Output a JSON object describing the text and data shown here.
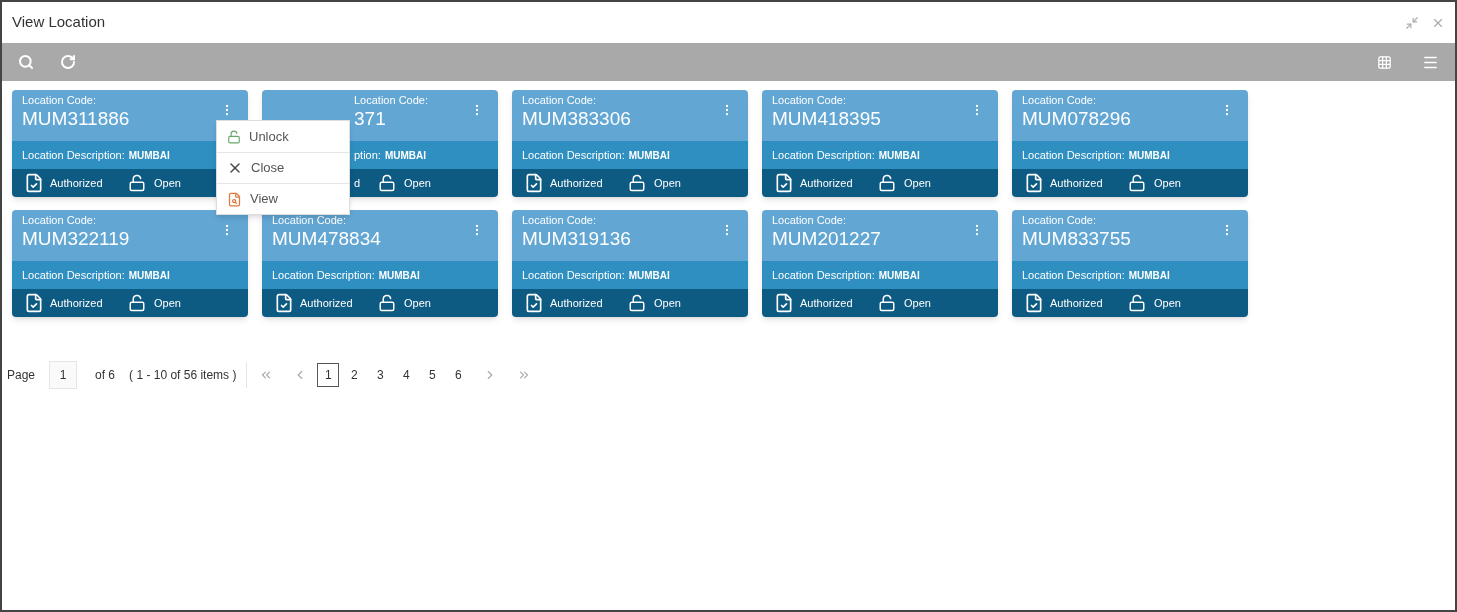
{
  "window": {
    "title": "View Location"
  },
  "cards": [
    {
      "code_label": "Location Code:",
      "code": "MUM311886",
      "desc_label": "Location Description:",
      "desc": "MUMBAI",
      "auth": "Authorized",
      "status": "Open",
      "covered": false
    },
    {
      "code_label": "Location Code:",
      "code": "371",
      "desc_label": "ption:",
      "desc": "MUMBAI",
      "auth": "d",
      "status": "Open",
      "covered": true
    },
    {
      "code_label": "Location Code:",
      "code": "MUM383306",
      "desc_label": "Location Description:",
      "desc": "MUMBAI",
      "auth": "Authorized",
      "status": "Open",
      "covered": false
    },
    {
      "code_label": "Location Code:",
      "code": "MUM418395",
      "desc_label": "Location Description:",
      "desc": "MUMBAI",
      "auth": "Authorized",
      "status": "Open",
      "covered": false
    },
    {
      "code_label": "Location Code:",
      "code": "MUM078296",
      "desc_label": "Location Description:",
      "desc": "MUMBAI",
      "auth": "Authorized",
      "status": "Open",
      "covered": false
    },
    {
      "code_label": "Location Code:",
      "code": "MUM322119",
      "desc_label": "Location Description:",
      "desc": "MUMBAI",
      "auth": "Authorized",
      "status": "Open",
      "covered": false
    },
    {
      "code_label": "Location Code:",
      "code": "MUM478834",
      "desc_label": "Location Description:",
      "desc": "MUMBAI",
      "auth": "Authorized",
      "status": "Open",
      "covered": false
    },
    {
      "code_label": "Location Code:",
      "code": "MUM319136",
      "desc_label": "Location Description:",
      "desc": "MUMBAI",
      "auth": "Authorized",
      "status": "Open",
      "covered": false
    },
    {
      "code_label": "Location Code:",
      "code": "MUM201227",
      "desc_label": "Location Description:",
      "desc": "MUMBAI",
      "auth": "Authorized",
      "status": "Open",
      "covered": false
    },
    {
      "code_label": "Location Code:",
      "code": "MUM833755",
      "desc_label": "Location Description:",
      "desc": "MUMBAI",
      "auth": "Authorized",
      "status": "Open",
      "covered": false
    }
  ],
  "menu": [
    {
      "kind": "unlock",
      "label": "Unlock"
    },
    {
      "kind": "close",
      "label": "Close"
    },
    {
      "kind": "view",
      "label": "View"
    }
  ],
  "pagination": {
    "label": "Page",
    "current": "1",
    "of": "of 6",
    "range": "( 1 - 10 of 56 items )",
    "pages": [
      {
        "label": "1",
        "selected": true
      },
      {
        "label": "2",
        "selected": false
      },
      {
        "label": "3",
        "selected": false
      },
      {
        "label": "4",
        "selected": false
      },
      {
        "label": "5",
        "selected": false
      },
      {
        "label": "6",
        "selected": false
      }
    ]
  }
}
